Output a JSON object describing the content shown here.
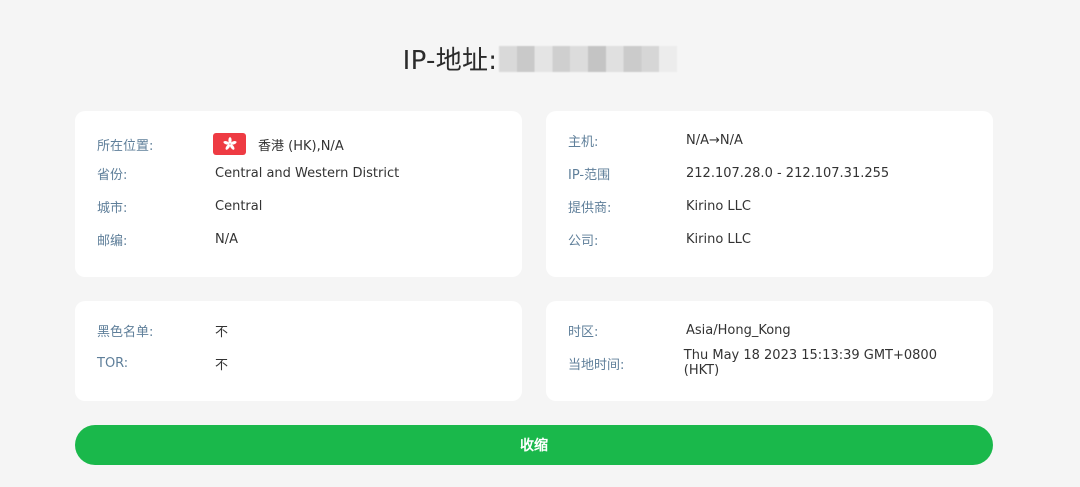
{
  "header": {
    "title_prefix": "IP-地址:"
  },
  "location_card": {
    "rows": [
      {
        "label": "所在位置:",
        "value": "香港 (HK),N/A",
        "icon": "hong-kong-flag-icon"
      },
      {
        "label": "省份:",
        "value": "Central and Western District"
      },
      {
        "label": "城市:",
        "value": "Central"
      },
      {
        "label": "邮编:",
        "value": "N/A"
      }
    ]
  },
  "network_card": {
    "rows": [
      {
        "label": "主机:",
        "value": "N/A→N/A"
      },
      {
        "label": "IP-范围",
        "value": "212.107.28.0 - 212.107.31.255"
      },
      {
        "label": "提供商:",
        "value": "Kirino LLC"
      },
      {
        "label": "公司:",
        "value": "Kirino LLC"
      }
    ]
  },
  "security_card": {
    "rows": [
      {
        "label": "黑色名单:",
        "value": "不"
      },
      {
        "label": "TOR:",
        "value": "不"
      }
    ]
  },
  "time_card": {
    "rows": [
      {
        "label": "时区:",
        "value": "Asia/Hong_Kong"
      },
      {
        "label": "当地时间:",
        "value": "Thu May 18 2023 15:13:39 GMT+0800 (HKT)"
      }
    ]
  },
  "actions": {
    "collapse_label": "收缩"
  },
  "colors": {
    "accent_green": "#1ab84b",
    "flag_red": "#ee3b43",
    "label_blue_gray": "#5f7f9a"
  }
}
